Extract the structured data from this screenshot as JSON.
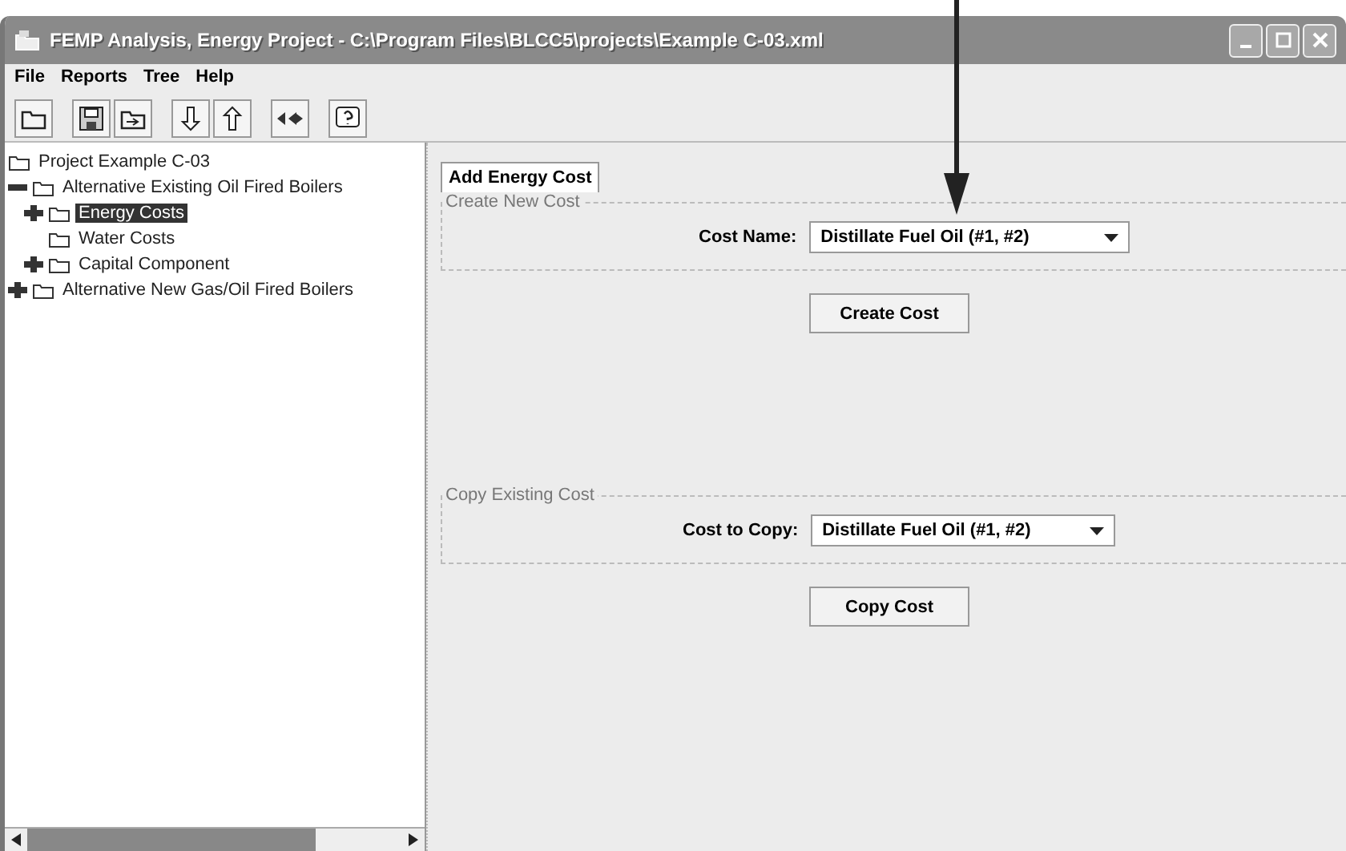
{
  "window": {
    "title": "FEMP Analysis, Energy Project - C:\\Program Files\\BLCC5\\projects\\Example C-03.xml"
  },
  "menu": [
    "File",
    "Reports",
    "Tree",
    "Help"
  ],
  "toolbar": [
    {
      "kind": "open"
    },
    {
      "kind": "save"
    },
    {
      "kind": "folder-arrow"
    },
    {
      "kind": "down"
    },
    {
      "kind": "up"
    },
    {
      "kind": "back-forward"
    },
    {
      "kind": "help"
    }
  ],
  "tree": [
    {
      "label": "Project Example C-03",
      "selected": false,
      "children": [
        {
          "label": "Alternative  Existing Oil Fired Boilers",
          "expanded": true,
          "selected": false,
          "children": [
            {
              "label": "Energy Costs",
              "expanded": false,
              "selected": true
            },
            {
              "label": "Water Costs",
              "selected": false
            },
            {
              "label": "Capital Component",
              "expanded": false,
              "selected": false
            }
          ]
        },
        {
          "label": "Alternative  New Gas/Oil Fired Boilers",
          "expanded": false,
          "selected": false
        }
      ]
    }
  ],
  "tabs": [
    {
      "label": "Add Energy Cost",
      "selected": true
    }
  ],
  "create": {
    "legend": "Create New Cost",
    "label": "Cost Name:",
    "value": "Distillate Fuel Oil (#1, #2)",
    "button": "Create Cost"
  },
  "copy": {
    "legend": "Copy Existing Cost",
    "label": "Cost to Copy:",
    "value": "Distillate Fuel Oil (#1, #2)",
    "button": "Copy Cost"
  }
}
